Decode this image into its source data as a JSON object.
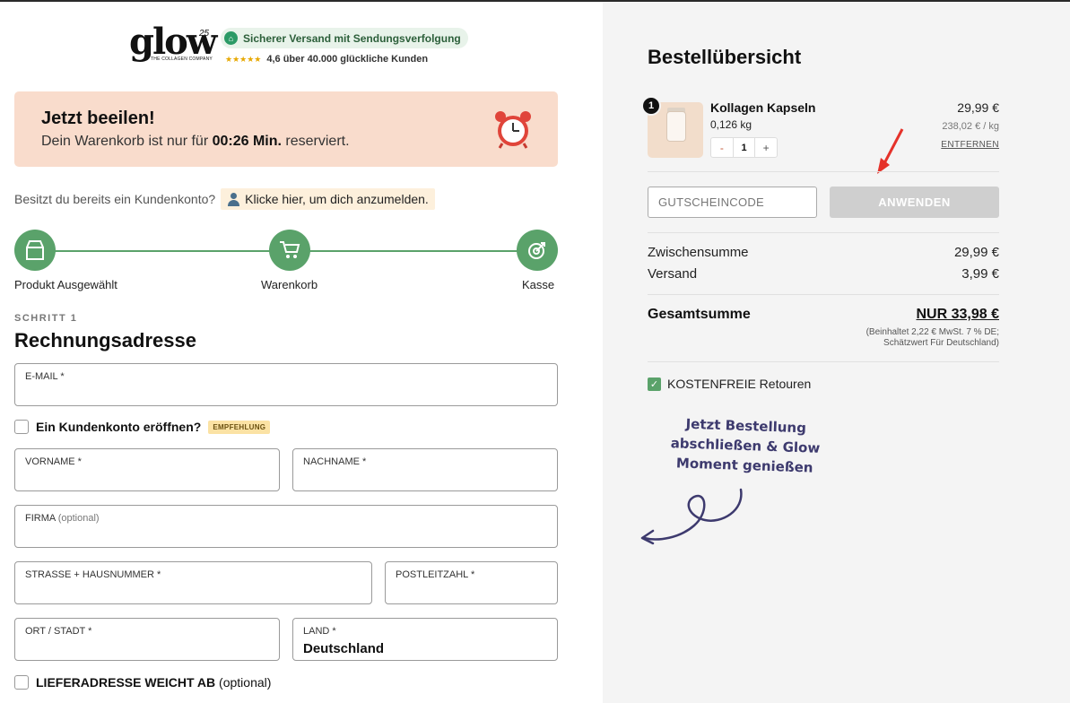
{
  "brand": {
    "logo_word": "glow",
    "logo_sup": "25",
    "logo_tagline": "THE COLLAGEN COMPANY"
  },
  "header": {
    "shipping_badge": "Sicherer Versand mit Sendungsverfolgung",
    "rating_stars": "★★★★★",
    "rating_text": "4,6 über 40.000 glückliche Kunden"
  },
  "banner": {
    "title": "Jetzt beeilen!",
    "text_before": "Dein Warenkorb ist nur für",
    "timer": "00:26 Min.",
    "text_after": "reserviert.",
    "icon": "alarm-clock-icon"
  },
  "account": {
    "question": "Besitzt du bereits ein Kundenkonto?",
    "login_link": "Klicke hier, um dich anzumelden."
  },
  "steps": [
    {
      "label": "Produkt Ausgewählt",
      "icon": "product-bag-icon"
    },
    {
      "label": "Warenkorb",
      "icon": "cart-icon"
    },
    {
      "label": "Kasse",
      "icon": "checkout-icon"
    }
  ],
  "form": {
    "step_number": "SCHRITT 1",
    "title": "Rechnungsadresse",
    "email_label": "E-MAIL *",
    "create_account_label": "Ein Kundenkonto eröffnen?",
    "create_account_badge": "EMPFEHLUNG",
    "firstname_label": "VORNAME *",
    "lastname_label": "NACHNAME *",
    "company_label": "FIRMA",
    "company_optional": "(optional)",
    "street_label": "STRASSE + HAUSNUMMER *",
    "zip_label": "POSTLEITZAHL *",
    "city_label": "ORT / STADT *",
    "country_label": "LAND *",
    "country_value": "Deutschland",
    "shipping_diff_label": "LIEFERADRESSE WEICHT AB",
    "shipping_diff_optional": "(optional)"
  },
  "summary": {
    "title": "Bestellübersicht",
    "item": {
      "name": "Kollagen Kapseln",
      "weight": "0,126 kg",
      "quantity_badge": "1",
      "quantity": "1",
      "minus": "-",
      "plus": "+",
      "price": "29,99 €",
      "unit_price": "238,02 € / kg",
      "remove": "ENTFERNEN"
    },
    "coupon_placeholder": "GUTSCHEINCODE",
    "apply_label": "ANWENDEN",
    "subtotal_label": "Zwischensumme",
    "subtotal_value": "29,99 €",
    "shipping_label": "Versand",
    "shipping_value": "3,99 €",
    "total_label": "Gesamtsumme",
    "total_value": "NUR 33,98 €",
    "tax_note_1": "(Beinhaltet 2,22 € MwSt. 7 % DE;",
    "tax_note_2": "Schätzwert Für Deutschland)",
    "returns_label": "KOSTENFREIE Retouren",
    "handwritten_1": "Jetzt Bestellung",
    "handwritten_2": "abschließen & Glow",
    "handwritten_3": "Moment genießen"
  },
  "colors": {
    "accent_green": "#5aa26a",
    "banner_bg": "#f9dccc",
    "right_bg": "#f4f4f4",
    "handwriting": "#3d3a6e",
    "arrow_red": "#e5322a"
  }
}
